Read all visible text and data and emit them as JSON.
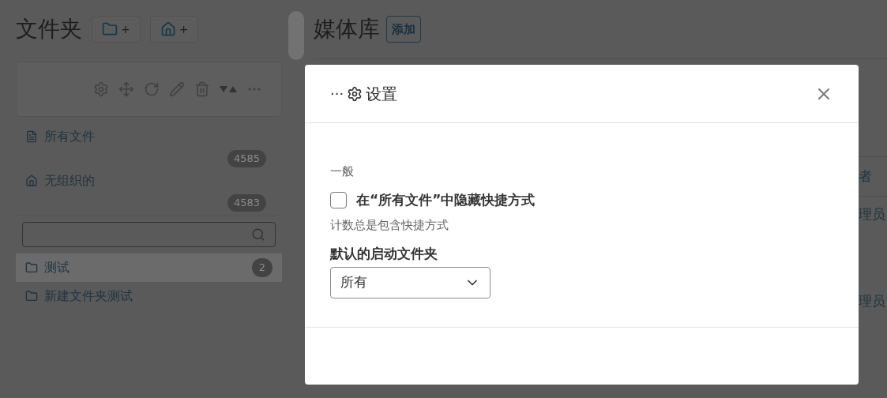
{
  "sidebar": {
    "title": "文件夹",
    "new_buttons": [
      {
        "kind": "folder",
        "label": "+"
      },
      {
        "kind": "home",
        "label": "+"
      }
    ],
    "tree": [
      {
        "kind": "file",
        "label": "所有文件",
        "count": "4585"
      },
      {
        "kind": "home",
        "label": "无组织的",
        "count": "4583"
      }
    ],
    "folders": [
      {
        "label": "测试",
        "count": "2",
        "selected": true
      },
      {
        "label": "新建文件夹测试",
        "selected": false
      }
    ]
  },
  "main": {
    "title": "媒体库",
    "add_button": "添加",
    "column_fragment": "者",
    "cell_fragments": [
      "理员",
      "理员"
    ]
  },
  "dialog": {
    "prefix": "···",
    "title": "设置",
    "section": "一般",
    "checkbox": {
      "label": "在“所有文件”中隐藏快捷方式",
      "checked": false
    },
    "hint": "计数总是包含快捷方式",
    "select_label": "默认的启动文件夹",
    "select_value": "所有"
  }
}
